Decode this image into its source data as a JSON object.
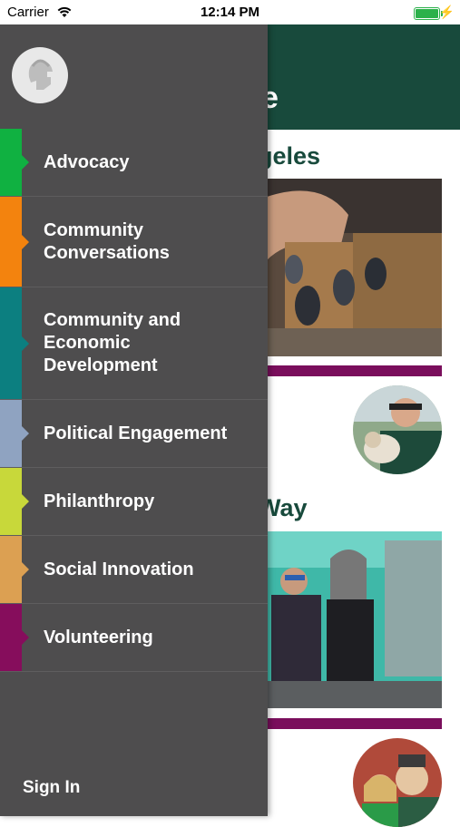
{
  "status_bar": {
    "carrier": "Carrier",
    "time": "12:14 PM"
  },
  "background": {
    "header_fragment": "e",
    "section1_title_fragment": "geles",
    "section2_title_fragment": "Way",
    "accent_color": "#7a0e5c",
    "header_color": "#184a3c"
  },
  "drawer": {
    "logo_icon": "spartan-helmet-icon",
    "menu_items": [
      {
        "label": "Advocacy",
        "color": "#10b141"
      },
      {
        "label": "Community Conversations",
        "color": "#f3830e"
      },
      {
        "label": "Community and Economic Development",
        "color": "#0c7f80"
      },
      {
        "label": "Political Engagement",
        "color": "#8fa3c1"
      },
      {
        "label": "Philanthropy",
        "color": "#c8d83a"
      },
      {
        "label": "Social Innovation",
        "color": "#dca052"
      },
      {
        "label": "Volunteering",
        "color": "#860d5c"
      }
    ],
    "sign_in_label": "Sign In"
  }
}
